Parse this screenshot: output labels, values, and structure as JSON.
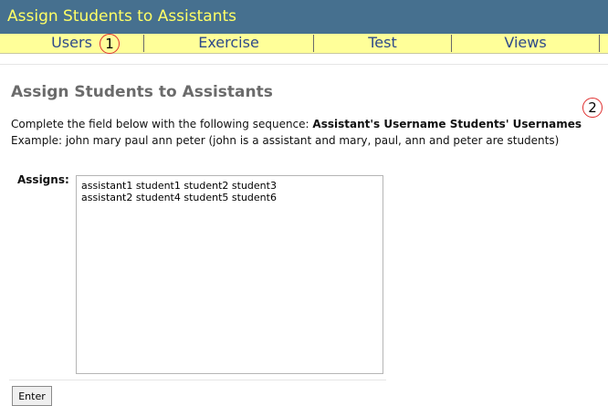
{
  "app": {
    "title": "Assign Students to Assistants"
  },
  "menu": {
    "items": [
      {
        "label": "Users"
      },
      {
        "label": "Exercise"
      },
      {
        "label": "Test"
      },
      {
        "label": "Views"
      }
    ]
  },
  "markers": {
    "first": "1",
    "second": "2"
  },
  "page": {
    "heading": "Assign Students to Assistants",
    "instruction_prefix": "Complete the field below with the following sequence: ",
    "instruction_sequence": "Assistant's Username Students' Usernames",
    "example": "Example: john mary paul ann peter (john is a assistant and mary, paul, ann and peter are students)"
  },
  "form": {
    "assigns_label": "Assigns:",
    "assigns_value": "assistant1 student1 student2 student3\nassistant2 student4 student5 student6",
    "submit_label": "Enter"
  },
  "colors": {
    "title_bar": "#46708f",
    "title_text": "#ffff66",
    "menu_bar": "#ffff99",
    "menu_text": "#2e4a8a",
    "marker_ring": "#e03030"
  }
}
